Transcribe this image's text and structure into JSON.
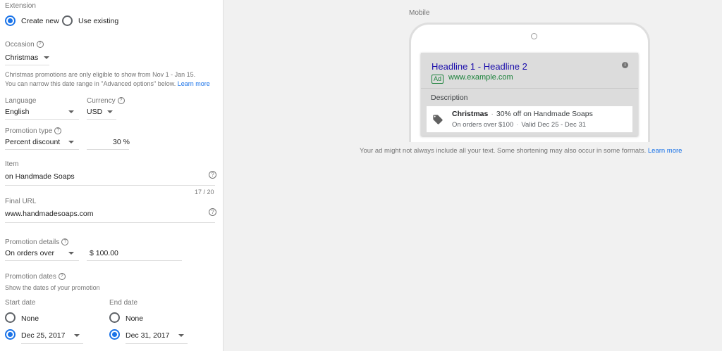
{
  "extension": {
    "label": "Extension",
    "options": [
      {
        "label": "Create new",
        "selected": true
      },
      {
        "label": "Use existing",
        "selected": false
      }
    ]
  },
  "occasion": {
    "label": "Occasion",
    "value": "Christmas",
    "note_line1": "Christmas promotions are only eligible to show from Nov 1 - Jan 15.",
    "note_line2": "You can narrow this date range in \"Advanced options\" below.",
    "learn_more": "Learn more"
  },
  "language": {
    "label": "Language",
    "value": "English"
  },
  "currency": {
    "label": "Currency",
    "value": "USD"
  },
  "promotion_type": {
    "label": "Promotion type",
    "value": "Percent discount",
    "amount": "30",
    "unit": "%"
  },
  "item": {
    "label": "Item",
    "value": "on Handmade Soaps",
    "counter": "17 / 20"
  },
  "final_url": {
    "label": "Final URL",
    "value": "www.handmadesoaps.com"
  },
  "promotion_details": {
    "label": "Promotion details",
    "value": "On orders over",
    "currency_symbol": "$",
    "amount": "100.00"
  },
  "promotion_dates": {
    "label": "Promotion dates",
    "hint": "Show the dates of your promotion",
    "start": {
      "label": "Start date",
      "none": "None",
      "value": "Dec 25, 2017",
      "selected": "date"
    },
    "end": {
      "label": "End date",
      "none": "None",
      "value": "Dec 31, 2017",
      "selected": "date"
    }
  },
  "preview": {
    "device_label": "Mobile",
    "headline": "Headline 1 - Headline 2",
    "info_glyph": "i",
    "ad_badge": "Ad",
    "display_url": "www.example.com",
    "description": "Description",
    "ext_occasion": "Christmas",
    "ext_separator": "·",
    "ext_offer": "30% off on Handmade Soaps",
    "ext_condition": "On orders over $100",
    "ext_dates": "Valid Dec 25 - Dec 31",
    "disclaimer": "Your ad might not always include all your text. Some shortening may also occur in some formats.",
    "learn_more": "Learn more"
  },
  "help_glyph": "?",
  "icons": {
    "help": "help-circle-icon",
    "dropdown": "caret-down-icon",
    "tag": "tag-icon",
    "info": "info-icon"
  },
  "colors": {
    "accent": "#1a73e8",
    "headline": "#1a0dab",
    "url_green": "#188038"
  }
}
